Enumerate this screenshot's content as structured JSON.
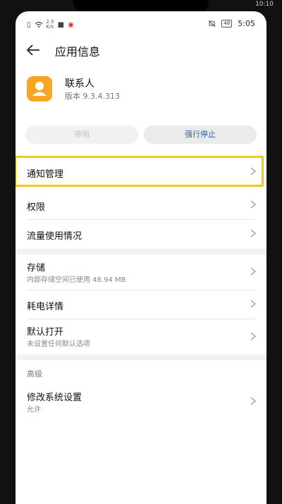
{
  "outer_status": {
    "left": "",
    "right": "10:10"
  },
  "status_bar": {
    "speed_top": "2.5",
    "speed_bottom": "K/s",
    "battery": "48",
    "time": "5:05"
  },
  "header": {
    "title": "应用信息"
  },
  "app": {
    "name": "联系人",
    "version": "版本 9.3.4.313"
  },
  "buttons": {
    "disable": "停用",
    "force_stop": "强行停止"
  },
  "items": {
    "notifications": "通知管理",
    "permissions": "权限",
    "data_usage": "流量使用情况",
    "storage": "存储",
    "storage_sub": "内部存储空间已使用 48.94 MB",
    "battery": "耗电详情",
    "open_default": "默认打开",
    "open_default_sub": "未设置任何默认选项",
    "advanced_header": "高级",
    "modify_settings": "修改系统设置",
    "modify_settings_sub": "允许"
  },
  "colors": {
    "app_icon": "#f5a623",
    "highlight": "#f5c518",
    "force_stop_text": "#2b5fb3"
  }
}
